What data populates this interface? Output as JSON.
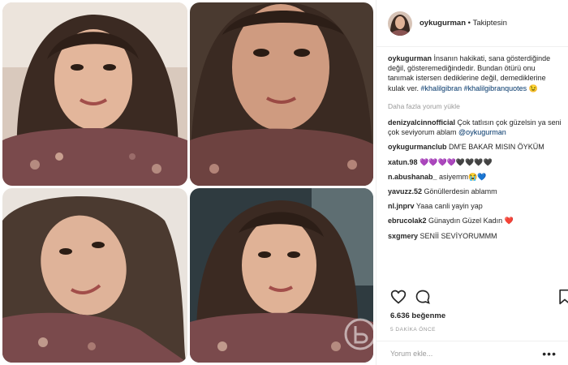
{
  "post": {
    "username": "oykugurman",
    "separator": "•",
    "follow_state": "Takiptesin",
    "caption": {
      "username": "oykugurman",
      "text": "İnsanın hakikati, sana gösterdiğinde değil, gösteremediğindedir. Bundan ötürü onu tanımak istersen dediklerine değil, demediklerine kulak ver.",
      "hashtag_1": "#khalilgibran",
      "hashtag_2": "#khalilgibranquotes",
      "emoji": "😉"
    },
    "load_more": "Daha fazla yorum yükle",
    "comments": [
      {
        "user": "denizyalcinnofficial",
        "text": "Çok tatlısın çok güzelsin ya seni çok seviyorum ablam",
        "mention": "@oykugurman"
      },
      {
        "user": "oykugurmanclub",
        "text": "DM'E BAKAR MISIN ÖYKÜM"
      },
      {
        "user": "xatun.98",
        "text": "💜💜💜💜🖤🖤🖤🖤"
      },
      {
        "user": "n.abushanab_",
        "text": "asiyemm😭💙"
      },
      {
        "user": "yavuzz.52",
        "text": "Gönüllerdesin ablamm"
      },
      {
        "user": "nl.jnprv",
        "text": "Yaaa canli yayin yap"
      },
      {
        "user": "ebrucolak2",
        "text": "Günaydın Güzel Kadın ❤️"
      },
      {
        "user": "sxgmery",
        "text": "SENİİ SEVİYORUMMM"
      }
    ],
    "likes": "6.636 beğenme",
    "timestamp": "5 DAKİKA ÖNCE",
    "comment_placeholder": "Yorum ekle...",
    "more_icon": "•••"
  },
  "icons": {
    "like": "heart-outline-icon",
    "comment": "speech-bubble-icon",
    "save": "bookmark-icon",
    "more": "more-options-icon",
    "watermark": "site-watermark-logo"
  },
  "colors": {
    "link": "#003569",
    "muted": "#999999",
    "text": "#262626",
    "border": "#efefef"
  }
}
